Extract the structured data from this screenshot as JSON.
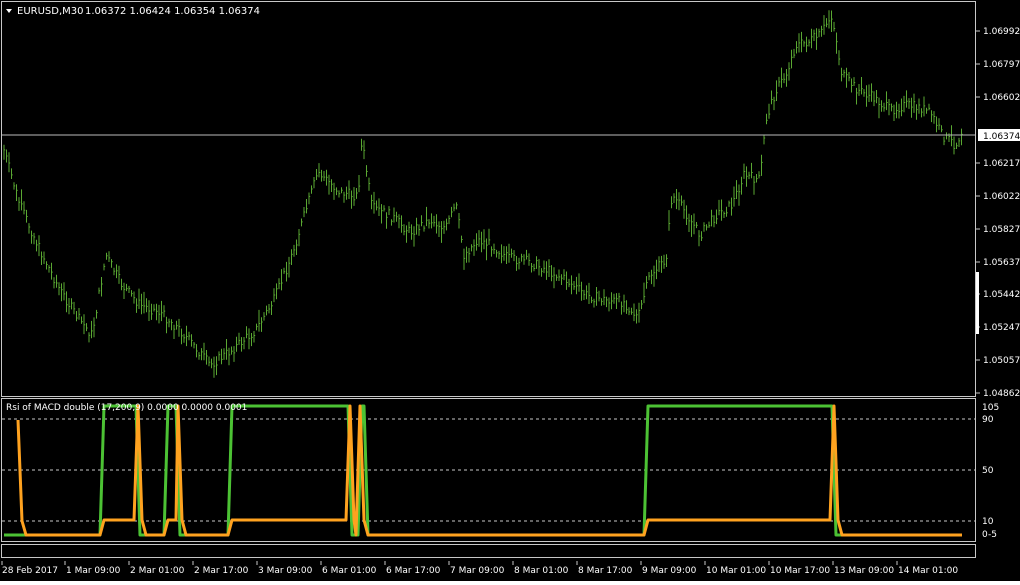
{
  "main_chart": {
    "symbol_button": "EURUSD,M30",
    "ohlc_text": "1.06372 1.06424 1.06354 1.06374",
    "current_price_label": "1.06374",
    "price_ticks": [
      "1.06992",
      "1.06797",
      "1.06602",
      "1.06217",
      "1.06022",
      "1.05827",
      "1.05637",
      "1.05442",
      "1.05247",
      "1.05057",
      "1.04862"
    ],
    "bar_color": "#5aa832",
    "bid_line_color": "#bdbdbd"
  },
  "indicator": {
    "title": "Rsi of MACD double (17,200,9) 0.0000 0.0000 0.0001",
    "level_ticks": [
      "105",
      "90",
      "50",
      "10",
      "0",
      "-5"
    ],
    "green_color": "#4cc234",
    "orange_color": "#ffa21f"
  },
  "time_axis": {
    "labels": [
      "28 Feb 2017",
      "1 Mar 09:00",
      "2 Mar 01:00",
      "2 Mar 17:00",
      "3 Mar 09:00",
      "6 Mar 01:00",
      "6 Mar 17:00",
      "7 Mar 09:00",
      "8 Mar 01:00",
      "8 Mar 17:00",
      "9 Mar 09:00",
      "10 Mar 01:00",
      "10 Mar 17:00",
      "13 Mar 09:00",
      "14 Mar 01:00"
    ]
  }
}
